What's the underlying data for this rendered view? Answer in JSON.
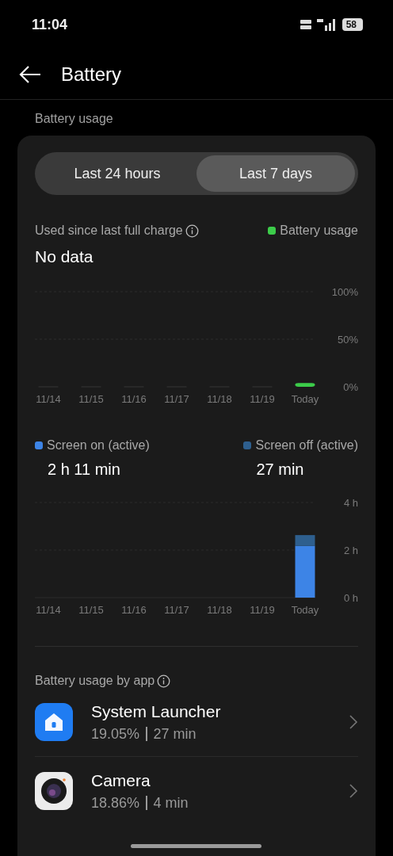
{
  "status_bar": {
    "time": "11:04",
    "battery": "58"
  },
  "header": {
    "title": "Battery"
  },
  "section_label": "Battery usage",
  "range_tabs": [
    {
      "label": "Last 24 hours",
      "selected": false
    },
    {
      "label": "Last 7 days",
      "selected": true
    }
  ],
  "usage_chart": {
    "title": "Used since last full charge",
    "summary": "No data",
    "chart_data": {
      "type": "bar",
      "categories": [
        "11/14",
        "11/15",
        "11/16",
        "11/17",
        "11/18",
        "11/19",
        "Today"
      ],
      "series": [
        {
          "name": "Battery usage",
          "color": "#3ccc4a",
          "values": [
            0,
            0,
            0,
            0,
            0,
            0,
            4
          ]
        }
      ],
      "ylim": [
        0,
        100
      ],
      "yticks": [
        {
          "value": 0,
          "label": "0%"
        },
        {
          "value": 50,
          "label": "50%"
        },
        {
          "value": 100,
          "label": "100%"
        }
      ]
    }
  },
  "screen_chart": {
    "totals": [
      "2 h 11 min",
      "27 min"
    ],
    "chart_data": {
      "type": "bar",
      "stacked": true,
      "categories": [
        "11/14",
        "11/15",
        "11/16",
        "11/17",
        "11/18",
        "11/19",
        "Today"
      ],
      "series": [
        {
          "name": "Screen on (active)",
          "color": "#3d84e6",
          "values": [
            0,
            0,
            0,
            0,
            0,
            0,
            2.18
          ]
        },
        {
          "name": "Screen off (active)",
          "color": "#2e5f8e",
          "values": [
            0,
            0,
            0,
            0,
            0,
            0,
            0.45
          ]
        }
      ],
      "ylim": [
        0,
        4
      ],
      "yticks": [
        {
          "value": 0,
          "label": "0 h"
        },
        {
          "value": 2,
          "label": "2 h"
        },
        {
          "value": 4,
          "label": "4 h"
        }
      ]
    }
  },
  "apps_title": "Battery usage by app",
  "apps": [
    {
      "kind": "launcher",
      "name": "System Launcher",
      "percent": "19.05%",
      "time": "27 min"
    },
    {
      "kind": "camera",
      "name": "Camera",
      "percent": "18.86%",
      "time": "4 min"
    }
  ]
}
